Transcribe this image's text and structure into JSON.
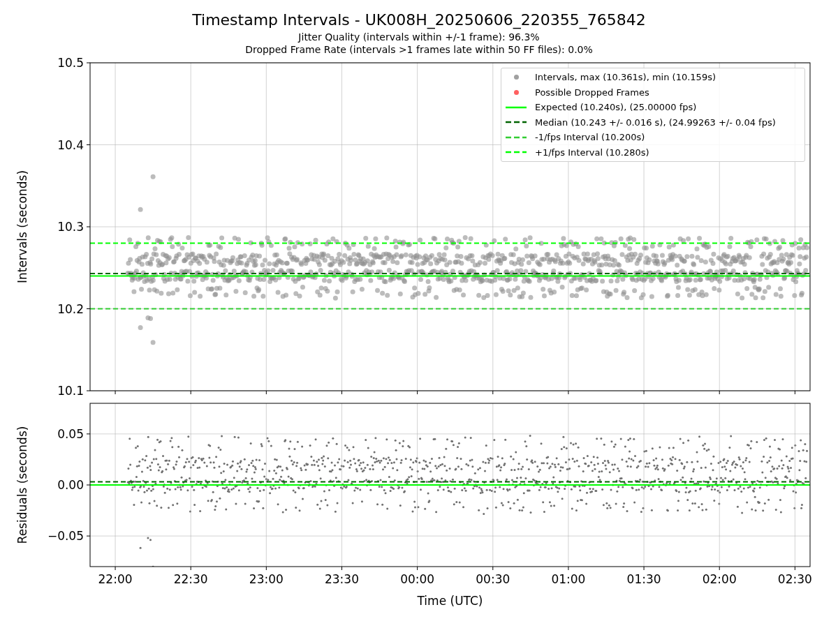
{
  "title": "Timestamp Intervals - UK008H_20250606_220355_765842",
  "subtitles": [
    "Jitter Quality (intervals within +/-1 frame): 96.3%",
    "Dropped Frame Rate (intervals >1 frames late within 50 FF files): 0.0%"
  ],
  "intervals_panel": {
    "marker_legend": [
      {
        "label": "Intervals, max (10.361s), min (10.159s)",
        "color": "#a0a0a0"
      },
      {
        "label": "Possible Dropped Frames",
        "color": "#ff6060"
      }
    ],
    "chart_data": {
      "type": "line",
      "ylabel": "Intervals (seconds)",
      "grid": true,
      "categories": [
        null,
        null,
        null,
        null,
        null,
        null,
        null,
        null,
        null,
        null
      ],
      "ylim": [
        10.1,
        10.5
      ],
      "yticks": [
        {
          "value": 10.1,
          "label": "10.1"
        },
        {
          "value": 10.2,
          "label": "10.2"
        },
        {
          "value": 10.3,
          "label": "10.3"
        },
        {
          "value": 10.4,
          "label": "10.4"
        },
        {
          "value": 10.5,
          "label": "10.5"
        }
      ],
      "ref_lines": [
        {
          "axis": "y",
          "value": 10.24,
          "label": "Expected (10.240s), (25.00000 fps)",
          "color": "#00ff00",
          "line_style": "solid"
        },
        {
          "axis": "y",
          "value": 10.243,
          "label": "Median (10.243 +/- 0.016 s), (24.99263 +/- 0.04 fps)",
          "color": "#006400",
          "line_style": "dashed"
        },
        {
          "axis": "y",
          "value": 10.2,
          "label": "-1/fps Interval (10.200s)",
          "color": "#32cd32",
          "line_style": "dashed"
        },
        {
          "axis": "y",
          "value": 10.28,
          "label": "+1/fps Interval (10.280s)",
          "color": "#00ff00",
          "line_style": "dashed"
        }
      ]
    }
  },
  "residuals_panel": {
    "chart_data": {
      "type": "line",
      "xlabel": "Time (UTC)",
      "ylabel": "Residuals (seconds)",
      "grid": true,
      "categories": [
        "22:00",
        "22:30",
        "23:00",
        "23:30",
        "00:00",
        "00:30",
        "01:00",
        "01:30",
        "02:00",
        "02:30"
      ],
      "ylim": [
        -0.08,
        0.08
      ],
      "yticks": [
        {
          "value": -0.05,
          "label": "−0.05"
        },
        {
          "value": 0,
          "label": "0.00"
        },
        {
          "value": 0.05,
          "label": "0.05"
        }
      ],
      "ref_lines": [
        {
          "axis": "y",
          "value": 0,
          "color": "#00ff00",
          "line_style": "solid"
        },
        {
          "axis": "y",
          "value": 0.003,
          "color": "#006400",
          "line_style": "dashed"
        }
      ]
    }
  }
}
